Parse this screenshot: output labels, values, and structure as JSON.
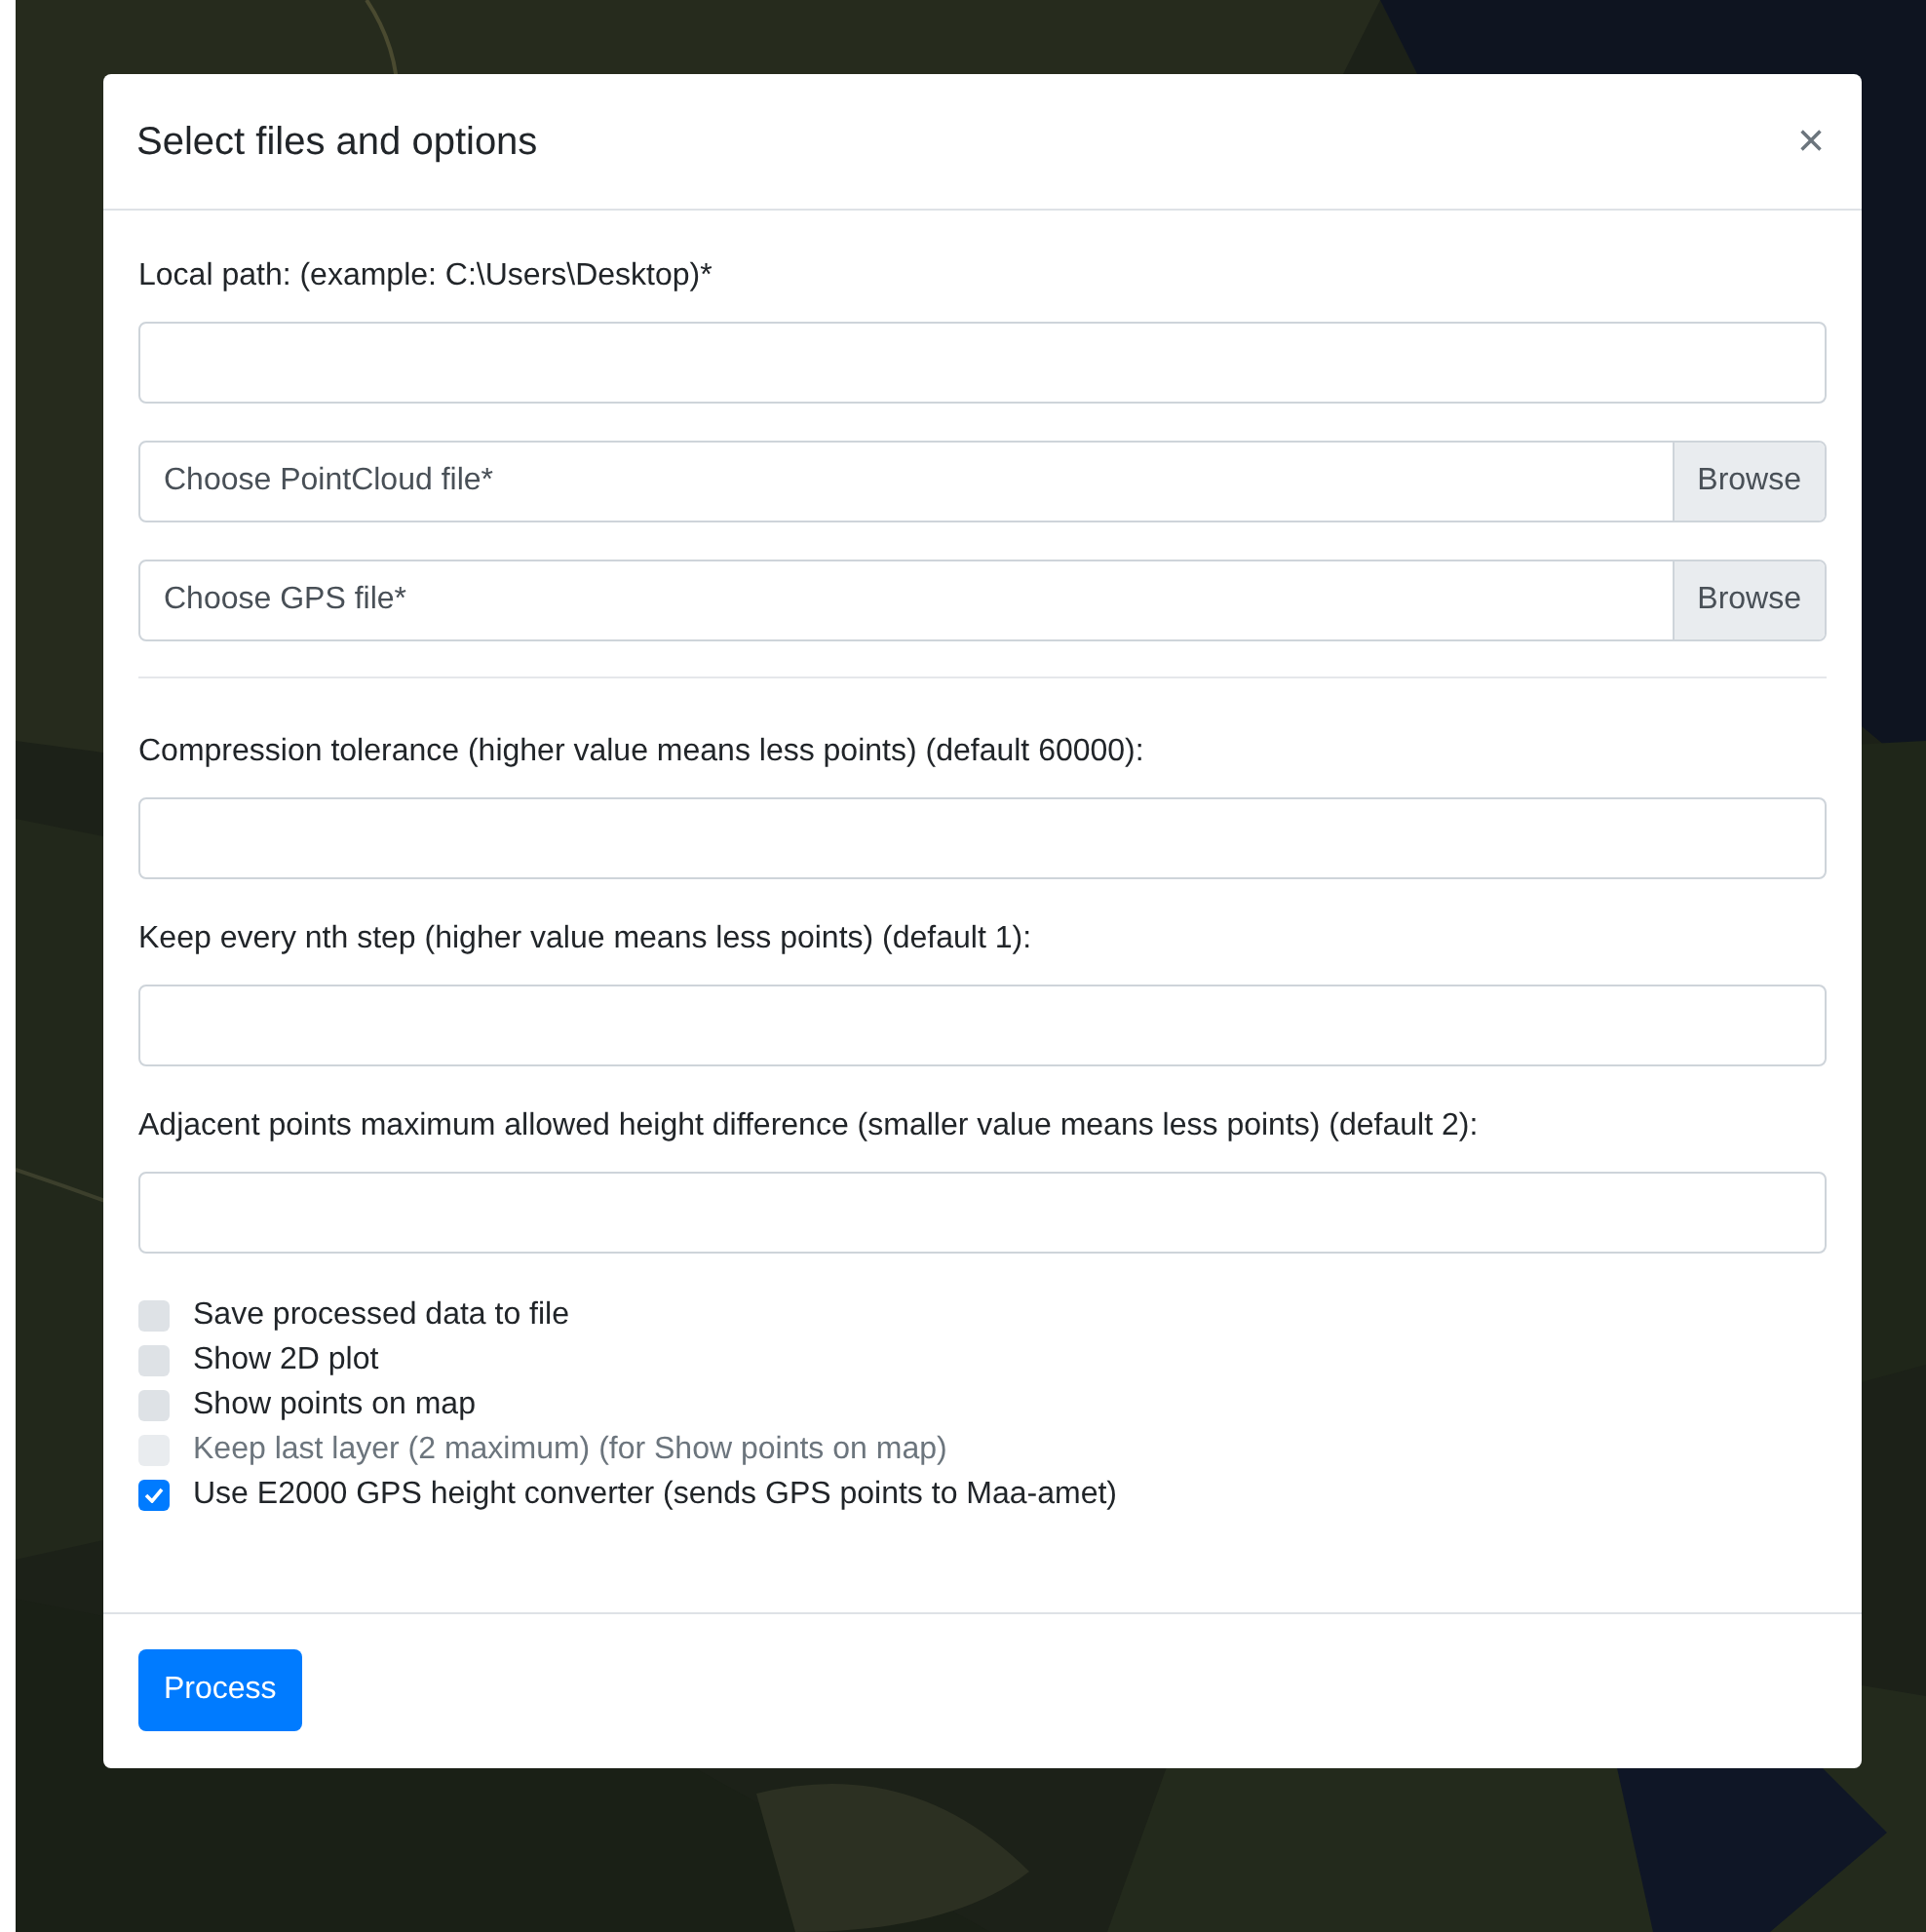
{
  "modal": {
    "title": "Select files and options",
    "close": "×",
    "fields": [
      {
        "kind": "text",
        "label": "Local path: (example: C:\\Users\\Desktop)*"
      },
      {
        "kind": "file",
        "placeholder": "Choose PointCloud file*",
        "button": "Browse"
      },
      {
        "kind": "file",
        "placeholder": "Choose GPS file*",
        "button": "Browse"
      },
      {
        "kind": "divider"
      },
      {
        "kind": "text",
        "label": "Compression tolerance (higher value means less points) (default 60000):"
      },
      {
        "kind": "text",
        "label": "Keep every nth step (higher value means less points) (default 1):"
      },
      {
        "kind": "text",
        "label": "Adjacent points maximum allowed height difference (smaller value means less points) (default 2):"
      }
    ],
    "checkboxes": [
      {
        "label": "Save processed data to file",
        "checked": false,
        "disabled": false
      },
      {
        "label": "Show 2D plot",
        "checked": false,
        "disabled": false
      },
      {
        "label": "Show points on map",
        "checked": false,
        "disabled": false
      },
      {
        "label": "Keep last layer (2 maximum) (for Show points on map)",
        "checked": false,
        "disabled": true
      },
      {
        "label": "Use E2000 GPS height converter (sends GPS points to Maa-amet)",
        "checked": true,
        "disabled": false
      }
    ],
    "submit": "Process"
  }
}
